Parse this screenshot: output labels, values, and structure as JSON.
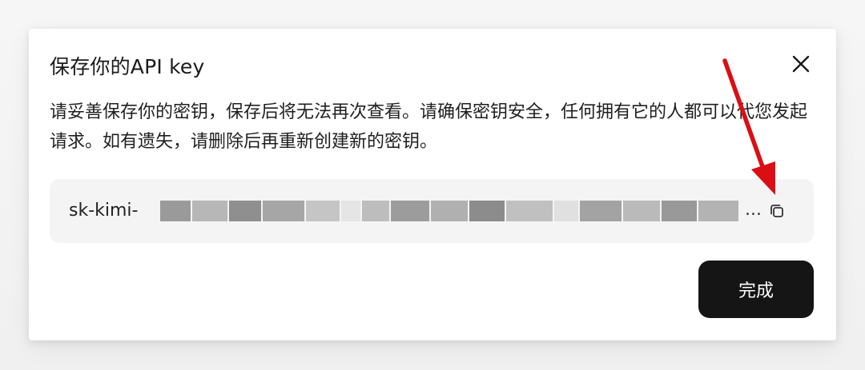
{
  "dialog": {
    "title": "保存你的API key",
    "description": "请妥善保存你的密钥，保存后将无法再次查看。请确保密钥安全，任何拥有它的人都可以代您发起请求。如有遗失，请删除后再重新创建新的密钥。",
    "key_prefix": "sk-kimi-",
    "key_ellipsis": "...",
    "done_label": "完成"
  },
  "icons": {
    "close": "close-icon",
    "copy": "copy-icon"
  },
  "colors": {
    "primary_button": "#151515",
    "key_field_bg": "#f4f4f5",
    "annotation_arrow": "#d90f15"
  }
}
